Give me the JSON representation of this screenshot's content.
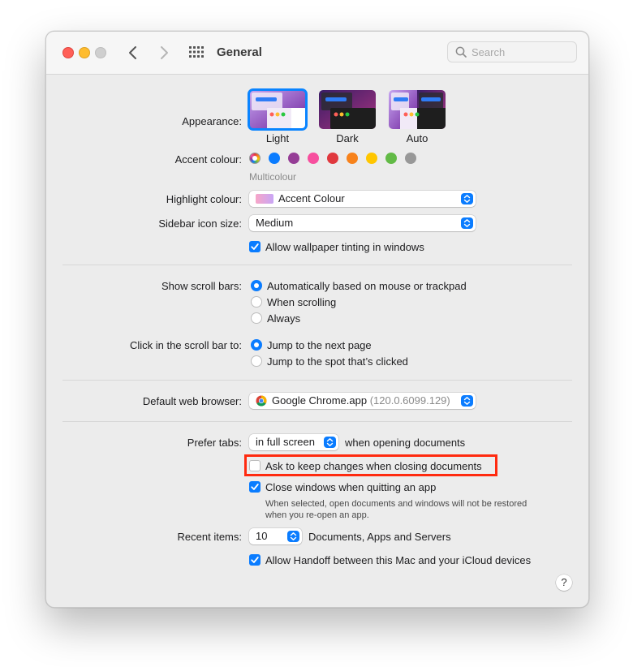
{
  "window": {
    "title": "General"
  },
  "search": {
    "placeholder": "Search",
    "value": ""
  },
  "appearance": {
    "label": "Appearance:",
    "options": [
      {
        "name": "Light",
        "selected": true
      },
      {
        "name": "Dark",
        "selected": false
      },
      {
        "name": "Auto",
        "selected": false
      }
    ]
  },
  "accent": {
    "label": "Accent colour:",
    "selected_name": "Multicolour",
    "colors": [
      "multicolour",
      "#0a7cff",
      "#953d96",
      "#f74f9e",
      "#e0383e",
      "#f7821b",
      "#ffc600",
      "#62ba46",
      "#989898"
    ]
  },
  "highlight": {
    "label": "Highlight colour:",
    "value": "Accent Colour"
  },
  "sidebar_icon": {
    "label": "Sidebar icon size:",
    "value": "Medium"
  },
  "wallpaper_tinting": {
    "label": "Allow wallpaper tinting in windows",
    "checked": true
  },
  "scroll_bars": {
    "label": "Show scroll bars:",
    "options": [
      {
        "label": "Automatically based on mouse or trackpad",
        "selected": true
      },
      {
        "label": "When scrolling",
        "selected": false
      },
      {
        "label": "Always",
        "selected": false
      }
    ]
  },
  "scroll_click": {
    "label": "Click in the scroll bar to:",
    "options": [
      {
        "label": "Jump to the next page",
        "selected": true
      },
      {
        "label": "Jump to the spot that’s clicked",
        "selected": false
      }
    ]
  },
  "browser": {
    "label": "Default web browser:",
    "app": "Google Chrome.app",
    "version": "(120.0.6099.129)"
  },
  "prefer_tabs": {
    "label": "Prefer tabs:",
    "value": "in full screen",
    "suffix": "when opening documents"
  },
  "ask_keep_changes": {
    "label": "Ask to keep changes when closing documents",
    "checked": false
  },
  "close_windows": {
    "label": "Close windows when quitting an app",
    "checked": true,
    "note_line1": "When selected, open documents and windows will not be restored",
    "note_line2": "when you re-open an app."
  },
  "recent_items": {
    "label": "Recent items:",
    "value": "10",
    "suffix": "Documents, Apps and Servers"
  },
  "handoff": {
    "label": "Allow Handoff between this Mac and your iCloud devices",
    "checked": true
  },
  "help": {
    "label": "?"
  },
  "colors": {
    "accent": "#0a7cff",
    "highlight_box": "#ff2a0f"
  }
}
